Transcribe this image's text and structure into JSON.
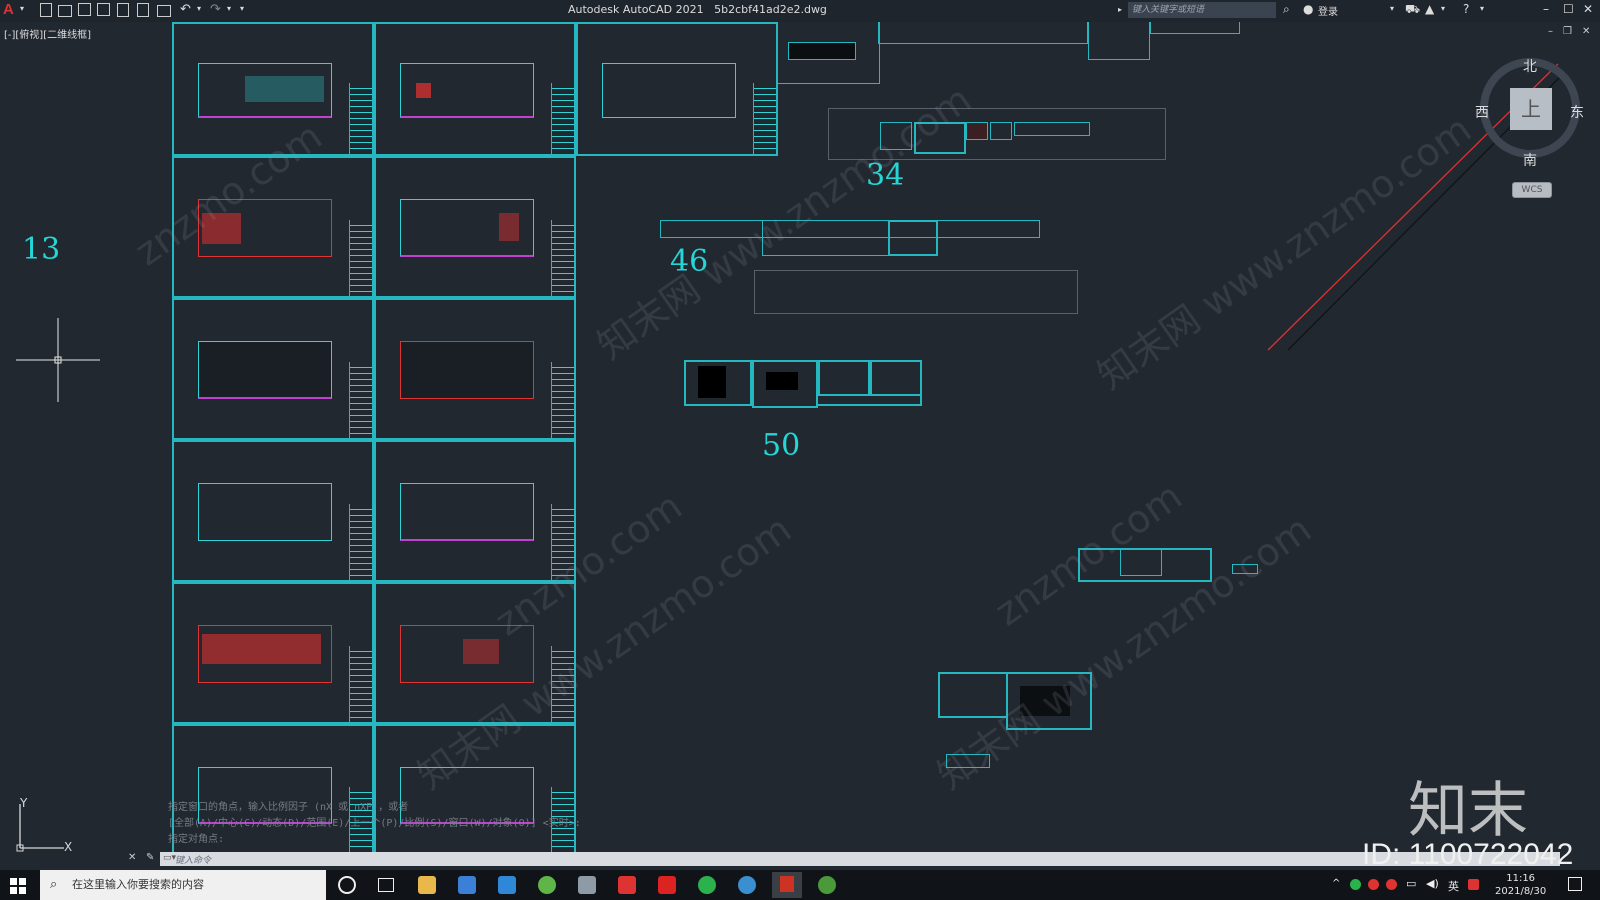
{
  "titlebar": {
    "app_name": "Autodesk AutoCAD 2021",
    "file_name": "5b2cbf41ad2e2.dwg",
    "search_placeholder": "键入关键字或短语",
    "login": "登录"
  },
  "viewport": {
    "label": "[-][俯视][二维线框]"
  },
  "drawing": {
    "labels": [
      "13",
      "34",
      "46",
      "50"
    ]
  },
  "viewcube": {
    "north": "北",
    "south": "南",
    "east": "东",
    "west": "西",
    "top_face": "上",
    "wcs": "WCS"
  },
  "ucs": {
    "x_label": "X",
    "y_label": "Y"
  },
  "command": {
    "history": [
      "指定窗口的角点，输入比例因子 (nX 或 nXP)，或者",
      "[全部(A)/中心(C)/动态(D)/范围(E)/上一个(P)/比例(S)/窗口(W)/对象(O)] <实时>:",
      "指定对角点:"
    ],
    "input_placeholder": "键入命令"
  },
  "taskbar": {
    "search_placeholder": "在这里输入你要搜索的内容",
    "time": "11:16",
    "date": "2021/8/30",
    "ime": "英"
  },
  "watermark": {
    "logo": "知末",
    "id": "ID: 1100722042",
    "site": "znzmo.com",
    "site_cn": "知末网 www.znzmo.com"
  },
  "colors": {
    "canvas": "#212830",
    "cyan": "#26b8c0",
    "label": "#25d6d6",
    "red": "#e03333",
    "magenta": "#c040d0"
  }
}
